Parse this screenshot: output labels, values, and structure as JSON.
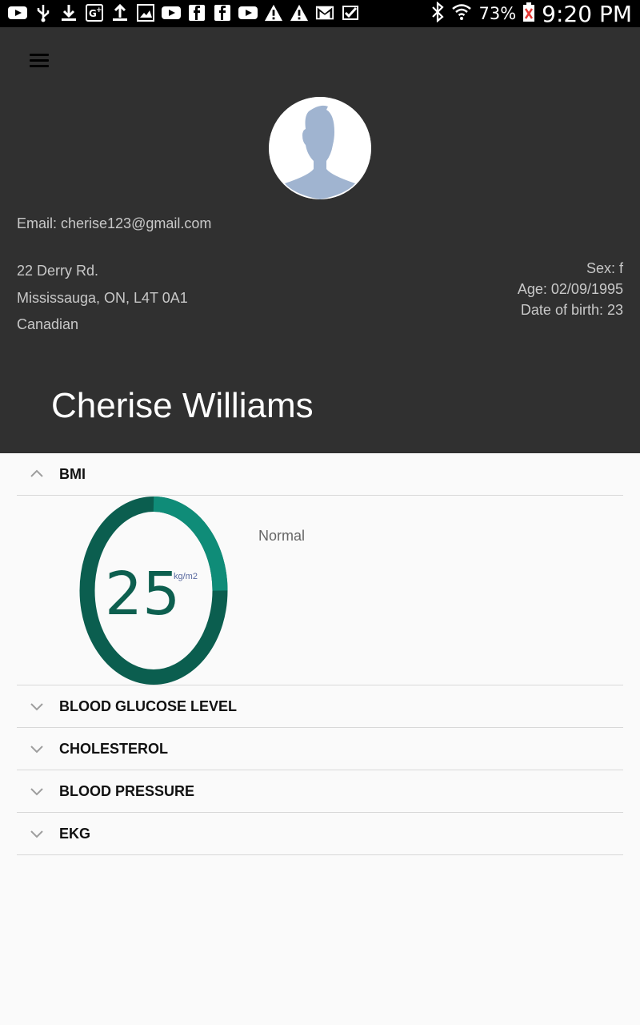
{
  "status_bar": {
    "battery_percent": "73%",
    "time": "9:20 PM",
    "left_icons": [
      "youtube-icon",
      "usb-icon",
      "download-icon",
      "google-plus-icon",
      "upload-icon",
      "image-icon",
      "youtube-icon",
      "facebook-icon",
      "facebook-icon",
      "youtube-icon",
      "warning-icon",
      "warning-icon",
      "gmail-icon",
      "check-icon"
    ],
    "right_icons": [
      "bluetooth-icon",
      "wifi-icon",
      "battery-icon"
    ]
  },
  "profile": {
    "email": "Email: cherise123@gmail.com",
    "address_line1": "22 Derry Rd.",
    "address_line2": "Mississauga, ON, L4T 0A1",
    "nationality": "Canadian",
    "sex": "Sex: f",
    "age": "Age: 02/09/1995",
    "date_of_birth": "Date of birth: 23",
    "name": "Cherise Williams"
  },
  "sections": {
    "bmi": {
      "label": "BMI",
      "value": "25",
      "unit": "kg/m2",
      "status": "Normal",
      "gauge_fraction": 0.25,
      "colors": {
        "track": "#0b5e4f",
        "highlight": "#0f8c78"
      }
    },
    "blood_glucose": {
      "label": "BLOOD GLUCOSE LEVEL"
    },
    "cholesterol": {
      "label": "CHOLESTEROL"
    },
    "blood_pressure": {
      "label": "BLOOD PRESSURE"
    },
    "ekg": {
      "label": "EKG"
    }
  }
}
